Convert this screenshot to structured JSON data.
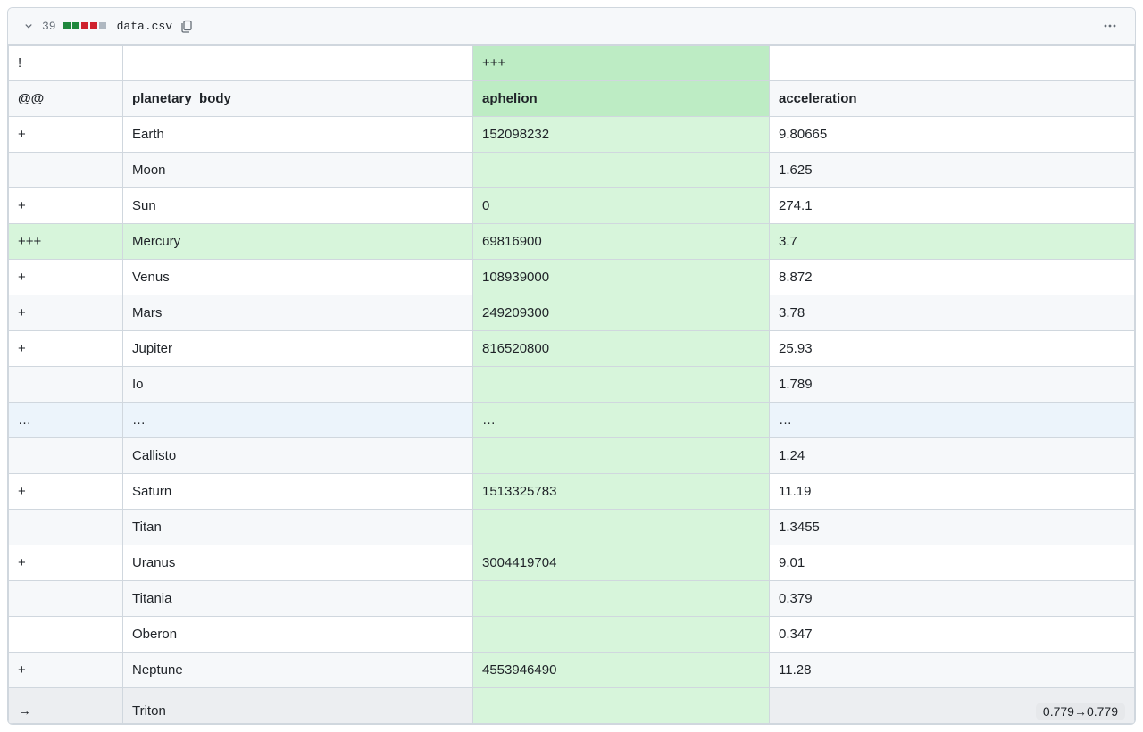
{
  "file": {
    "line_count": "39",
    "name": "data.csv"
  },
  "diffbar": [
    "add",
    "add",
    "del",
    "del",
    "neutral"
  ],
  "columns": {
    "marker": "@@",
    "body": "planetary_body",
    "aphelion": "aphelion",
    "accel": "acceleration"
  },
  "top_marker_row": {
    "marker": "!",
    "body": "",
    "aphelion": "+++",
    "accel": ""
  },
  "rows": [
    {
      "style": "white",
      "marker": "+",
      "body": "Earth",
      "aph": "152098232",
      "accel": "9.80665",
      "aph_green": true
    },
    {
      "style": "gray",
      "marker": "",
      "body": "Moon",
      "aph": "",
      "accel": "1.625",
      "aph_green": true
    },
    {
      "style": "white",
      "marker": "+",
      "body": "Sun",
      "aph": "0",
      "accel": "274.1",
      "aph_green": true
    },
    {
      "style": "green",
      "marker": "+++",
      "body": "Mercury",
      "aph": "69816900",
      "accel": "3.7",
      "aph_green": true
    },
    {
      "style": "white",
      "marker": "+",
      "body": "Venus",
      "aph": "108939000",
      "accel": "8.872",
      "aph_green": true
    },
    {
      "style": "gray",
      "marker": "+",
      "body": "Mars",
      "aph": "249209300",
      "accel": "3.78",
      "aph_green": true
    },
    {
      "style": "white",
      "marker": "+",
      "body": "Jupiter",
      "aph": "816520800",
      "accel": "25.93",
      "aph_green": true
    },
    {
      "style": "gray",
      "marker": "",
      "body": "Io",
      "aph": "",
      "accel": "1.789",
      "aph_green": true
    },
    {
      "style": "blue",
      "marker": "…",
      "body": "…",
      "aph": "…",
      "accel": "…",
      "aph_green": true
    },
    {
      "style": "gray",
      "marker": "",
      "body": "Callisto",
      "aph": "",
      "accel": "1.24",
      "aph_green": true
    },
    {
      "style": "white",
      "marker": "+",
      "body": "Saturn",
      "aph": "1513325783",
      "accel": "11.19",
      "aph_green": true
    },
    {
      "style": "gray",
      "marker": "",
      "body": "Titan",
      "aph": "",
      "accel": "1.3455",
      "aph_green": true
    },
    {
      "style": "white",
      "marker": "+",
      "body": "Uranus",
      "aph": "3004419704",
      "accel": "9.01",
      "aph_green": true
    },
    {
      "style": "gray",
      "marker": "",
      "body": "Titania",
      "aph": "",
      "accel": "0.379",
      "aph_green": true
    },
    {
      "style": "white",
      "marker": "",
      "body": "Oberon",
      "aph": "",
      "accel": "0.347",
      "aph_green": true
    },
    {
      "style": "gray",
      "marker": "+",
      "body": "Neptune",
      "aph": "4553946490",
      "accel": "11.28",
      "aph_green": true
    }
  ],
  "partial_row": {
    "marker": "→",
    "body": "Triton",
    "change_text": "0.779→0.779"
  }
}
